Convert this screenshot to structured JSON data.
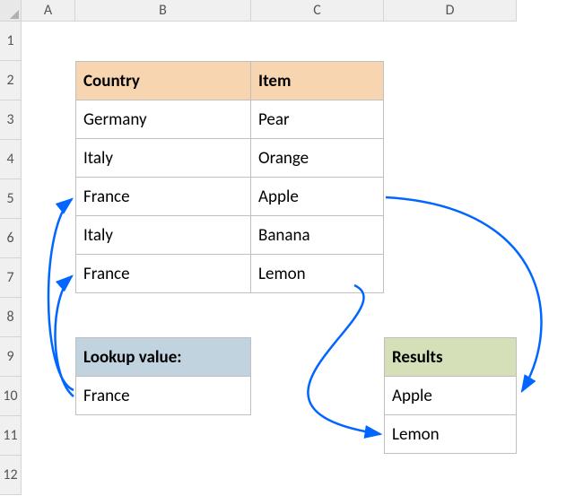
{
  "columns": [
    "A",
    "B",
    "C",
    "D"
  ],
  "rows": [
    "1",
    "2",
    "3",
    "4",
    "5",
    "6",
    "7",
    "8",
    "9",
    "10",
    "11",
    "12"
  ],
  "table1": {
    "headers": {
      "country": "Country",
      "item": "Item"
    },
    "rows": [
      {
        "country": "Germany",
        "item": "Pear"
      },
      {
        "country": "Italy",
        "item": "Orange"
      },
      {
        "country": "France",
        "item": "Apple"
      },
      {
        "country": "Italy",
        "item": "Banana"
      },
      {
        "country": "France",
        "item": "Lemon"
      }
    ]
  },
  "lookup": {
    "label": "Lookup value:",
    "value": "France"
  },
  "results": {
    "label": "Results",
    "values": [
      "Apple",
      "Lemon"
    ]
  },
  "arrowColor": "#0066ff"
}
